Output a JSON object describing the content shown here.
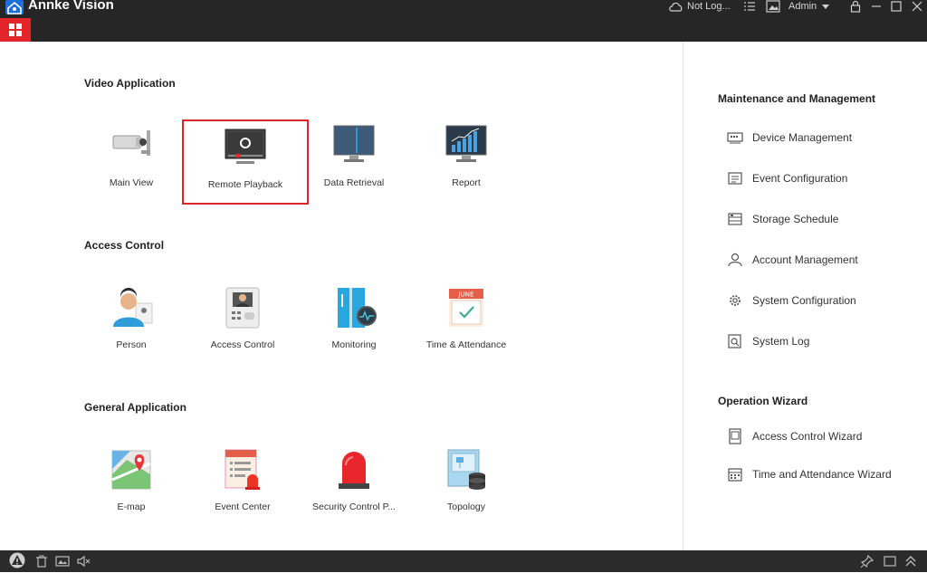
{
  "app": {
    "title": "Annke Vision"
  },
  "header": {
    "cloud_status": "Not Log...",
    "user": "Admin"
  },
  "sections": [
    {
      "title": "Video Application",
      "tiles": [
        {
          "label": "Main View",
          "icon": "camera-icon"
        },
        {
          "label": "Remote Playback",
          "icon": "playback-icon",
          "selected": true
        },
        {
          "label": "Data Retrieval",
          "icon": "data-retrieval-icon"
        },
        {
          "label": "Report",
          "icon": "report-icon"
        }
      ]
    },
    {
      "title": "Access Control",
      "tiles": [
        {
          "label": "Person",
          "icon": "person-icon"
        },
        {
          "label": "Access Control",
          "icon": "access-control-icon"
        },
        {
          "label": "Monitoring",
          "icon": "monitoring-icon"
        },
        {
          "label": "Time & Attendance",
          "icon": "calendar-icon"
        }
      ]
    },
    {
      "title": "General Application",
      "tiles": [
        {
          "label": "E-map",
          "icon": "map-icon"
        },
        {
          "label": "Event Center",
          "icon": "event-center-icon"
        },
        {
          "label": "Security Control P...",
          "icon": "alarm-light-icon"
        },
        {
          "label": "Topology",
          "icon": "topology-icon"
        }
      ]
    }
  ],
  "sidebar": {
    "maintenance_title": "Maintenance and Management",
    "maintenance_items": [
      {
        "label": "Device Management",
        "icon": "device-icon"
      },
      {
        "label": "Event Configuration",
        "icon": "event-config-icon"
      },
      {
        "label": "Storage Schedule",
        "icon": "storage-icon"
      },
      {
        "label": "Account Management",
        "icon": "account-icon"
      },
      {
        "label": "System Configuration",
        "icon": "gear-icon"
      },
      {
        "label": "System Log",
        "icon": "log-icon"
      }
    ],
    "wizard_title": "Operation Wizard",
    "wizard_items": [
      {
        "label": "Access Control Wizard",
        "icon": "wizard-doc-icon"
      },
      {
        "label": "Time and Attendance Wizard",
        "icon": "wizard-calendar-icon"
      }
    ]
  },
  "calendar_month": "JUNE",
  "colors": {
    "accent_red": "#d9262c",
    "titlebar": "#262626",
    "statusbar": "#2b2b2b"
  }
}
